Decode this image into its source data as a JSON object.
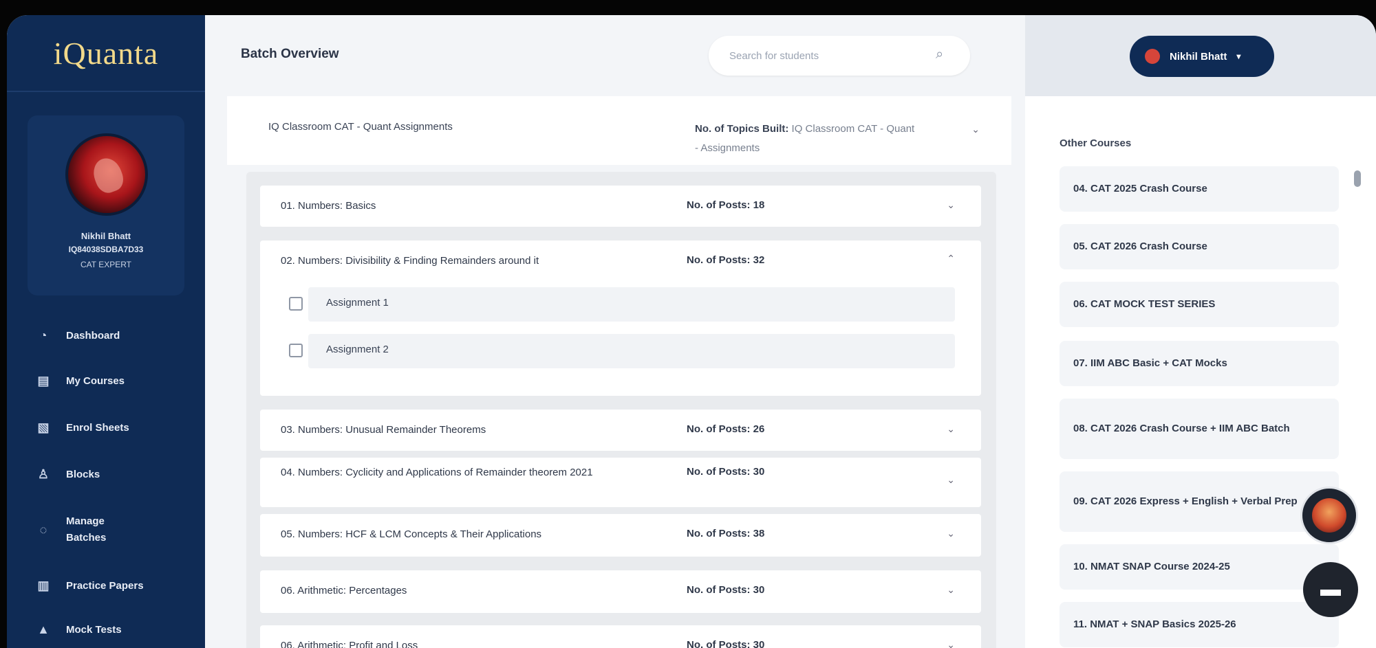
{
  "sidebar": {
    "logo": "iQuanta",
    "profile": {
      "name": "Nikhil Bhatt",
      "id": "IQ84038SDBA7D33",
      "role": "CAT EXPERT"
    },
    "items": [
      {
        "label": "Dashboard",
        "icon": "dashboard-icon"
      },
      {
        "label": "My Courses",
        "icon": "courses-icon"
      },
      {
        "label": "Enrol Sheets",
        "icon": "sheets-icon"
      },
      {
        "label": "Blocks",
        "icon": "blocks-icon"
      },
      {
        "label": "Manage Batches",
        "icon": "manage-icon"
      },
      {
        "label": "Practice Papers",
        "icon": "papers-icon"
      },
      {
        "label": "Mock Tests",
        "icon": "mock-icon"
      }
    ]
  },
  "header": {
    "title": "Batch Overview",
    "search_placeholder": "Search for students",
    "user_button": "Nikhil Bhatt"
  },
  "main": {
    "course_title": "IQ Classroom CAT - Quant Assignments",
    "header_posts_prefix": "No. of Topics Built:",
    "header_posts_course": "IQ Classroom CAT - Quant",
    "header_posts_suffix": "- Assignments",
    "modules": [
      {
        "title": "01. Numbers: Basics",
        "posts": "No. of Posts: 18",
        "expanded": false
      },
      {
        "title": "02. Numbers: Divisibility & Finding Remainders around it",
        "posts": "No. of Posts: 32",
        "expanded": true,
        "subs": [
          "Assignment 1",
          "Assignment 2"
        ]
      },
      {
        "title": "03. Numbers: Unusual Remainder Theorems",
        "posts": "No. of Posts: 26",
        "expanded": false
      },
      {
        "title": "04. Numbers: Cyclicity and Applications of Remainder theorem 2021",
        "posts": "No. of Posts: 30",
        "expanded": false
      },
      {
        "title": "05. Numbers: HCF & LCM Concepts & Their Applications",
        "posts": "No. of Posts: 38",
        "expanded": false
      },
      {
        "title": "06. Arithmetic: Percentages",
        "posts": "No. of Posts: 30",
        "expanded": false
      },
      {
        "title": "06. Arithmetic: Profit and Loss",
        "posts": "No. of Posts: 30",
        "expanded": false
      }
    ]
  },
  "right_panel": {
    "title": "Other Courses",
    "courses": [
      "04. CAT 2025 Crash Course",
      "05. CAT 2026 Crash Course",
      "06. CAT MOCK TEST SERIES",
      "07. IIM ABC Basic + CAT Mocks",
      "08. CAT 2026 Crash Course + IIM ABC Batch",
      "09. CAT 2026 Express + English + Verbal Prep",
      "10. NMAT SNAP Course 2024-25",
      "11. NMAT + SNAP Basics 2025-26"
    ]
  },
  "colors": {
    "sidebar": "#0f2b55",
    "accent": "#f2d98a"
  }
}
